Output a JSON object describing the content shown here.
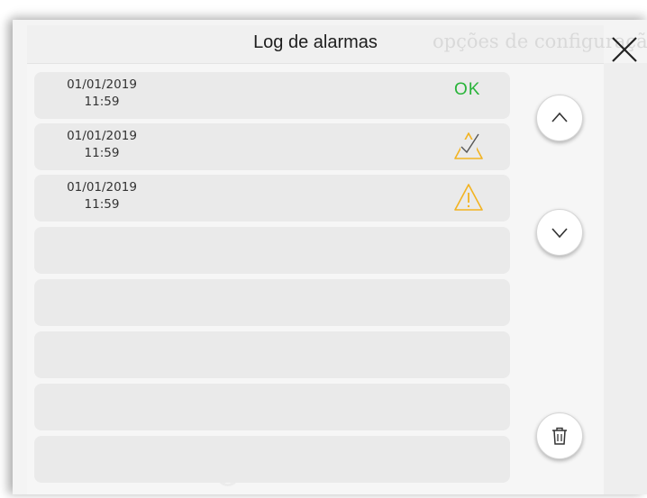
{
  "dialog": {
    "title": "Log de alarmas",
    "background_text": "opções de configuração"
  },
  "entries": [
    {
      "date": "01/01/2019",
      "time": "11:59",
      "status": "ok",
      "status_label": "OK",
      "icon": "ok-text"
    },
    {
      "date": "01/01/2019",
      "time": "11:59",
      "status": "acknowledged",
      "icon": "warning-checked-icon"
    },
    {
      "date": "01/01/2019",
      "time": "11:59",
      "status": "alarm",
      "icon": "warning-icon"
    }
  ],
  "colors": {
    "ok": "#29b43a",
    "warning": "#f2b321",
    "row_bg": "#eaeaea",
    "panel_bg": "#f6f6f6"
  },
  "controls": {
    "scroll_up": "chevron-up-icon",
    "scroll_down": "chevron-down-icon",
    "delete": "trash-icon",
    "close": "close-icon"
  }
}
